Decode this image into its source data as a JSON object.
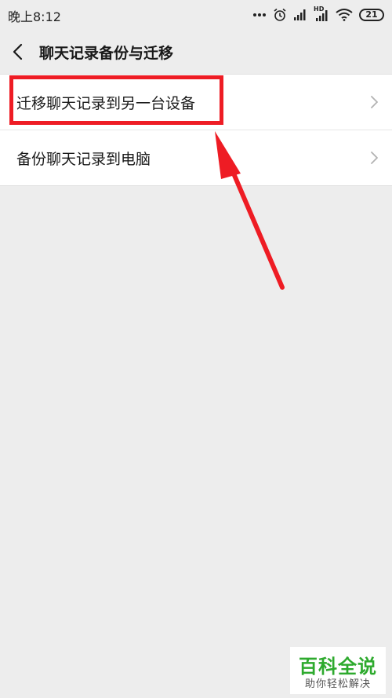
{
  "status_bar": {
    "time": "晚上8:12",
    "network_badge": "HD",
    "battery_level": "21",
    "icons": [
      "more-dots-icon",
      "alarm-icon",
      "signal-icon",
      "hd-signal-icon",
      "wifi-icon",
      "battery-icon"
    ]
  },
  "nav": {
    "back_icon": "chevron-left-icon",
    "title": "聊天记录备份与迁移"
  },
  "menu": {
    "items": [
      {
        "label": "迁移聊天记录到另一台设备",
        "icon": "chevron-right-icon"
      },
      {
        "label": "备份聊天记录到电脑",
        "icon": "chevron-right-icon"
      }
    ]
  },
  "annotation": {
    "color": "#ee1c24"
  },
  "watermark": {
    "title": "百科全说",
    "subtitle": "助你轻松解决"
  }
}
